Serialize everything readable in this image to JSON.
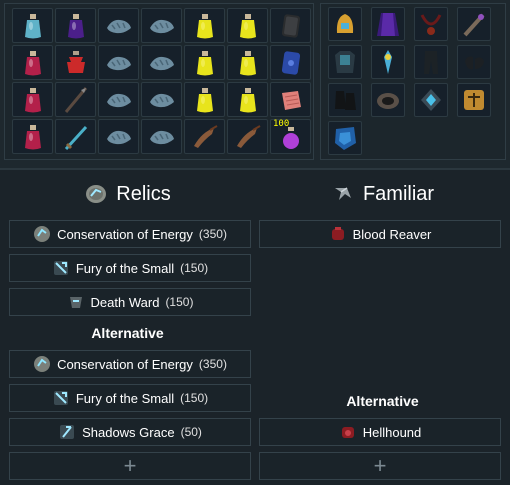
{
  "inventory": {
    "slots": [
      {
        "icon": "prayer-potion-blue-icon"
      },
      {
        "icon": "purple-potion-icon"
      },
      {
        "icon": "blue-shark-food-icon"
      },
      {
        "icon": "blue-shark-food-icon"
      },
      {
        "icon": "yellow-potion-icon"
      },
      {
        "icon": "yellow-potion-icon"
      },
      {
        "icon": "black-book-icon"
      },
      {
        "icon": "red-potion-icon"
      },
      {
        "icon": "red-super-potion-icon"
      },
      {
        "icon": "blue-shark-food-icon"
      },
      {
        "icon": "blue-shark-food-icon"
      },
      {
        "icon": "yellow-potion-icon"
      },
      {
        "icon": "yellow-potion-icon"
      },
      {
        "icon": "blue-book-icon"
      },
      {
        "icon": "red-potion-icon"
      },
      {
        "icon": "dark-staff-icon"
      },
      {
        "icon": "blue-shark-food-icon"
      },
      {
        "icon": "blue-shark-food-icon"
      },
      {
        "icon": "yellow-potion-icon"
      },
      {
        "icon": "yellow-potion-icon"
      },
      {
        "icon": "pink-scroll-icon"
      },
      {
        "icon": "red-potion-icon"
      },
      {
        "icon": "blue-sword-icon"
      },
      {
        "icon": "blue-shark-food-icon"
      },
      {
        "icon": "blue-shark-food-icon"
      },
      {
        "icon": "fish-icon"
      },
      {
        "icon": "fish-icon"
      },
      {
        "icon": "magenta-potion-icon",
        "qty": "100"
      }
    ]
  },
  "equipment": {
    "slots": [
      {
        "icon": "gold-helmet-icon"
      },
      {
        "icon": "purple-cape-icon"
      },
      {
        "icon": "amulet-icon"
      },
      {
        "icon": "wand-icon"
      },
      {
        "icon": ""
      },
      {
        "icon": "body-armour-icon"
      },
      {
        "icon": "blue-totem-icon"
      },
      {
        "icon": "legs-armour-icon"
      },
      {
        "icon": "gloves-icon"
      },
      {
        "icon": ""
      },
      {
        "icon": "boots-icon"
      },
      {
        "icon": "ring-icon"
      },
      {
        "icon": "blue-gem-icon"
      },
      {
        "icon": "book-of-balance-icon"
      },
      {
        "icon": ""
      },
      {
        "icon": "blue-shield-icon"
      },
      {
        "icon": ""
      },
      {
        "icon": ""
      },
      {
        "icon": ""
      },
      {
        "icon": ""
      }
    ]
  },
  "relics": {
    "title": "Relics",
    "items": [
      {
        "name": "Conservation of Energy",
        "points": "(350)",
        "icon": "conservation-icon"
      },
      {
        "name": "Fury of the Small",
        "points": "(150)",
        "icon": "fury-icon"
      },
      {
        "name": "Death Ward",
        "points": "(150)",
        "icon": "death-ward-icon"
      }
    ],
    "alt_label": "Alternative",
    "alt_items": [
      {
        "name": "Conservation of Energy",
        "points": "(350)",
        "icon": "conservation-icon"
      },
      {
        "name": "Fury of the Small",
        "points": "(150)",
        "icon": "fury-icon"
      },
      {
        "name": "Shadows Grace",
        "points": "(50)",
        "icon": "shadows-grace-icon"
      }
    ],
    "add_label": "+"
  },
  "familiar": {
    "title": "Familiar",
    "items": [
      {
        "name": "Blood Reaver",
        "icon": "blood-reaver-icon"
      }
    ],
    "alt_label": "Alternative",
    "alt_items": [
      {
        "name": "Hellhound",
        "icon": "hellhound-icon"
      }
    ],
    "add_label": "+"
  }
}
